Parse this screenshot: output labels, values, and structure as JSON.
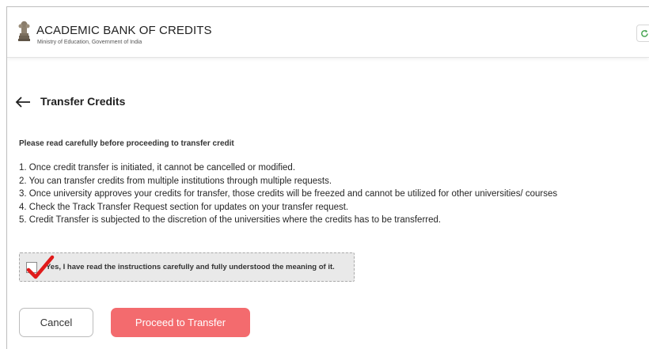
{
  "header": {
    "title": "ACADEMIC BANK OF CREDITS",
    "subtitle": "Ministry of Education, Government of India",
    "emblem_icon": "national-emblem-icon",
    "action_icon": "refresh-icon"
  },
  "page": {
    "back_icon": "arrow-left-icon",
    "title": "Transfer Credits"
  },
  "notice": "Please read carefully before proceeding to transfer credit",
  "instructions": [
    "1. Once credit transfer is initiated, it cannot be cancelled or modified.",
    "2. You can transfer credits from multiple institutions through multiple requests.",
    "3. Once university approves your credits for transfer, those credits will be freezed and cannot be utilized for other universities/ courses",
    "4. Check the Track Transfer Request section for updates on your transfer request.",
    "5. Credit Transfer is subjected to the discretion of the universities where the credits has to be transferred."
  ],
  "consent": {
    "label": "Yes, I have read the instructions carefully and fully understood the meaning of it.",
    "checked": false,
    "annotation_icon": "red-checkmark-icon"
  },
  "buttons": {
    "cancel": "Cancel",
    "proceed": "Proceed to Transfer"
  },
  "colors": {
    "accent": "#f36b6e",
    "checkmark": "#e01b1b",
    "consent_bg": "#e9e9e9"
  }
}
